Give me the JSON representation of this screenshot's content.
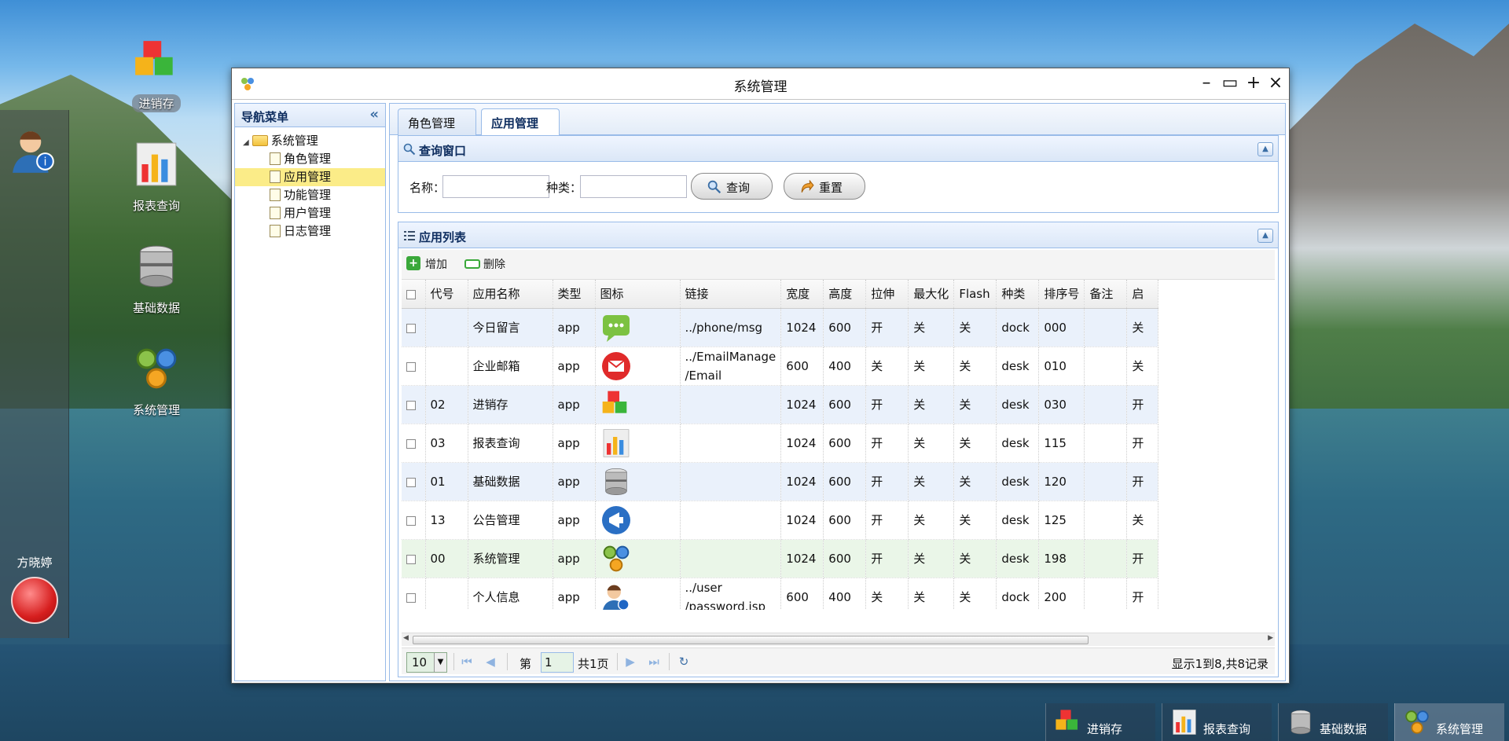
{
  "desktop": {
    "icons": [
      {
        "label": "进销存",
        "icon": "cubes-icon",
        "selected": true
      },
      {
        "label": "报表查询",
        "icon": "bar-chart-icon",
        "selected": false
      },
      {
        "label": "基础数据",
        "icon": "database-icon",
        "selected": false
      },
      {
        "label": "系统管理",
        "icon": "gears-icon",
        "selected": false
      }
    ]
  },
  "sidebar": {
    "user_name": "方晓婷",
    "user_icon": "user-info-icon",
    "power_icon": "power-icon"
  },
  "window": {
    "title": "系统管理",
    "controls": {
      "minimize": "–",
      "maximize": "▭",
      "move": "+",
      "close": "×"
    }
  },
  "nav": {
    "title": "导航菜单",
    "collapse_glyph": "«",
    "root": "系统管理",
    "items": [
      {
        "label": "角色管理",
        "selected": false
      },
      {
        "label": "应用管理",
        "selected": true
      },
      {
        "label": "功能管理",
        "selected": false
      },
      {
        "label": "用户管理",
        "selected": false
      },
      {
        "label": "日志管理",
        "selected": false
      }
    ]
  },
  "tabs": [
    {
      "label": "角色管理",
      "close": "×",
      "active": false
    },
    {
      "label": "应用管理",
      "close": "×",
      "active": true
    }
  ],
  "query": {
    "title": "查询窗口",
    "name_label": "名称：",
    "name_value": "",
    "type_label": "种类：",
    "type_value": "",
    "search_button": "查询",
    "reset_button": "重置"
  },
  "list": {
    "title": "应用列表",
    "add_button": "增加",
    "delete_button": "删除",
    "columns": [
      "代号",
      "应用名称",
      "类型",
      "图标",
      "链接",
      "宽度",
      "高度",
      "拉伸",
      "最大化",
      "Flash",
      "种类",
      "排序号",
      "备注",
      "启"
    ],
    "rows": [
      {
        "code": "",
        "name": "今日留言",
        "type": "app",
        "icon": "message-icon",
        "link": "../phone/msg",
        "width": "1024",
        "height": "600",
        "stretch": "开",
        "max": "关",
        "flash": "关",
        "kind": "dock",
        "order": "000",
        "note": "",
        "enabled": "关"
      },
      {
        "code": "",
        "name": "企业邮箱",
        "type": "app",
        "icon": "email-icon",
        "link": "../EmailManage\n/Email",
        "width": "600",
        "height": "400",
        "stretch": "关",
        "max": "关",
        "flash": "关",
        "kind": "desk",
        "order": "010",
        "note": "",
        "enabled": "关"
      },
      {
        "code": "02",
        "name": "进销存",
        "type": "app",
        "icon": "cubes-icon",
        "link": "",
        "width": "1024",
        "height": "600",
        "stretch": "开",
        "max": "关",
        "flash": "关",
        "kind": "desk",
        "order": "030",
        "note": "",
        "enabled": "开"
      },
      {
        "code": "03",
        "name": "报表查询",
        "type": "app",
        "icon": "bar-chart-icon",
        "link": "",
        "width": "1024",
        "height": "600",
        "stretch": "开",
        "max": "关",
        "flash": "关",
        "kind": "desk",
        "order": "115",
        "note": "",
        "enabled": "开"
      },
      {
        "code": "01",
        "name": "基础数据",
        "type": "app",
        "icon": "database-icon",
        "link": "",
        "width": "1024",
        "height": "600",
        "stretch": "开",
        "max": "关",
        "flash": "关",
        "kind": "desk",
        "order": "120",
        "note": "",
        "enabled": "开"
      },
      {
        "code": "13",
        "name": "公告管理",
        "type": "app",
        "icon": "megaphone-icon",
        "link": "",
        "width": "1024",
        "height": "600",
        "stretch": "开",
        "max": "关",
        "flash": "关",
        "kind": "desk",
        "order": "125",
        "note": "",
        "enabled": "关"
      },
      {
        "code": "00",
        "name": "系统管理",
        "type": "app",
        "icon": "gears-icon",
        "link": "",
        "width": "1024",
        "height": "600",
        "stretch": "开",
        "max": "关",
        "flash": "关",
        "kind": "desk",
        "order": "198",
        "note": "",
        "enabled": "开"
      },
      {
        "code": "",
        "name": "个人信息",
        "type": "app",
        "icon": "user-info-icon",
        "link": "../user\n/password.jsp",
        "width": "600",
        "height": "400",
        "stretch": "关",
        "max": "关",
        "flash": "关",
        "kind": "dock",
        "order": "200",
        "note": "",
        "enabled": "开"
      }
    ]
  },
  "pager": {
    "page_size": "10",
    "page_prefix": "第",
    "page_number": "1",
    "page_suffix": "共1页",
    "summary": "显示1到8,共8记录"
  },
  "taskbar": [
    {
      "label": "进销存",
      "icon": "cubes-icon",
      "active": false
    },
    {
      "label": "报表查询",
      "icon": "bar-chart-icon",
      "active": false
    },
    {
      "label": "基础数据",
      "icon": "database-icon",
      "active": false
    },
    {
      "label": "系统管理",
      "icon": "gears-icon",
      "active": true
    }
  ]
}
